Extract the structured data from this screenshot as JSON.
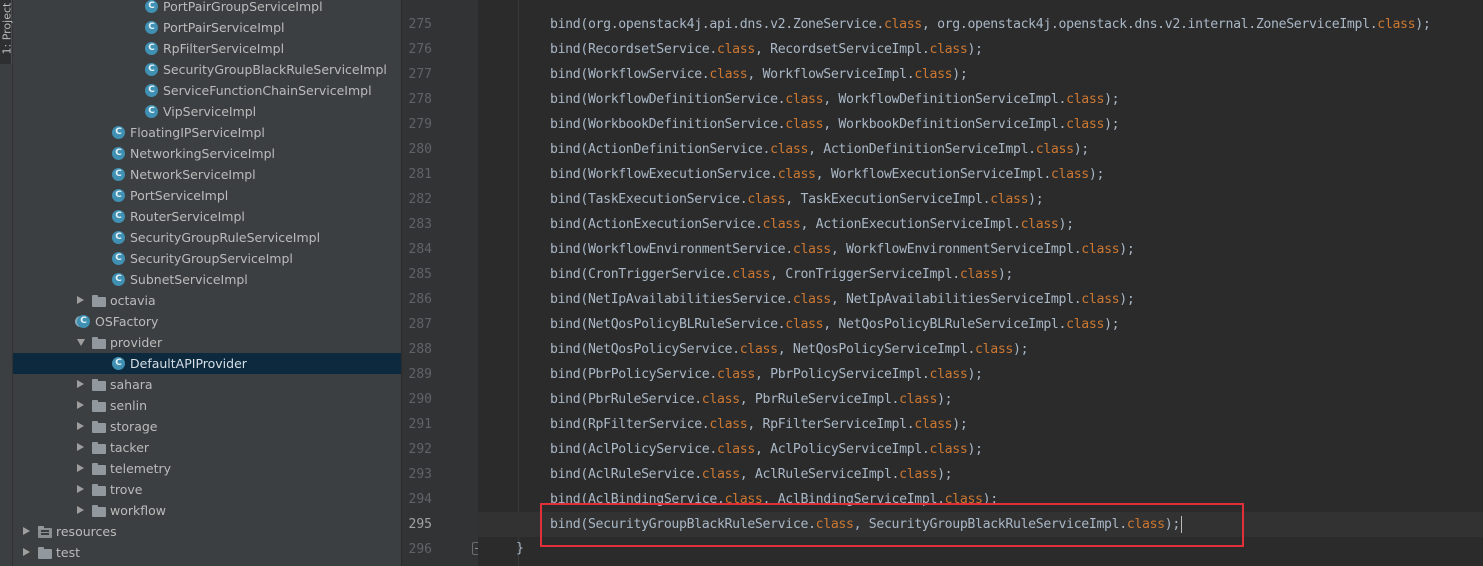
{
  "tool_strip": {
    "project_tab_label": "1: Project"
  },
  "project_tree": {
    "items": [
      {
        "label": "PortPairGroupServiceImpl",
        "kind": "class",
        "indent": 3
      },
      {
        "label": "PortPairServiceImpl",
        "kind": "class",
        "indent": 3
      },
      {
        "label": "RpFilterServiceImpl",
        "kind": "class",
        "indent": 3
      },
      {
        "label": "SecurityGroupBlackRuleServiceImpl",
        "kind": "class",
        "indent": 3
      },
      {
        "label": "ServiceFunctionChainServiceImpl",
        "kind": "class",
        "indent": 3
      },
      {
        "label": "VipServiceImpl",
        "kind": "class",
        "indent": 3
      },
      {
        "label": "FloatingIPServiceImpl",
        "kind": "class",
        "indent": 2
      },
      {
        "label": "NetworkingServiceImpl",
        "kind": "class",
        "indent": 2
      },
      {
        "label": "NetworkServiceImpl",
        "kind": "class",
        "indent": 2
      },
      {
        "label": "PortServiceImpl",
        "kind": "class",
        "indent": 2
      },
      {
        "label": "RouterServiceImpl",
        "kind": "class",
        "indent": 2
      },
      {
        "label": "SecurityGroupRuleServiceImpl",
        "kind": "class",
        "indent": 2
      },
      {
        "label": "SecurityGroupServiceImpl",
        "kind": "class",
        "indent": 2
      },
      {
        "label": "SubnetServiceImpl",
        "kind": "class",
        "indent": 2
      },
      {
        "label": "octavia",
        "kind": "folder",
        "indent": 1,
        "arrow": "right"
      },
      {
        "label": "OSFactory",
        "kind": "factory",
        "indent": 1
      },
      {
        "label": "provider",
        "kind": "folder",
        "indent": 1,
        "arrow": "down"
      },
      {
        "label": "DefaultAPIProvider",
        "kind": "class",
        "indent": 2,
        "selected": true
      },
      {
        "label": "sahara",
        "kind": "folder",
        "indent": 1,
        "arrow": "right"
      },
      {
        "label": "senlin",
        "kind": "folder",
        "indent": 1,
        "arrow": "right"
      },
      {
        "label": "storage",
        "kind": "folder",
        "indent": 1,
        "arrow": "right"
      },
      {
        "label": "tacker",
        "kind": "folder",
        "indent": 1,
        "arrow": "right"
      },
      {
        "label": "telemetry",
        "kind": "folder",
        "indent": 1,
        "arrow": "right"
      },
      {
        "label": "trove",
        "kind": "folder",
        "indent": 1,
        "arrow": "right"
      },
      {
        "label": "workflow",
        "kind": "folder",
        "indent": 1,
        "arrow": "right"
      },
      {
        "label": "resources",
        "kind": "res-folder",
        "indent": 0,
        "arrow": "right"
      },
      {
        "label": "test",
        "kind": "folder",
        "indent": 0,
        "arrow": "right"
      }
    ]
  },
  "editor": {
    "lines": [
      {
        "num": "275",
        "a": "bind(org.openstack4j.api.dns.v2.ZoneService.",
        "b": ", org.openstack4j.openstack.dns.v2.internal.ZoneServiceImpl.",
        "c": ");"
      },
      {
        "num": "276",
        "a": "bind(RecordsetService.",
        "b": ", RecordsetServiceImpl.",
        "c": ");"
      },
      {
        "num": "277",
        "a": "bind(WorkflowService.",
        "b": ", WorkflowServiceImpl.",
        "c": ");"
      },
      {
        "num": "278",
        "a": "bind(WorkflowDefinitionService.",
        "b": ", WorkflowDefinitionServiceImpl.",
        "c": ");"
      },
      {
        "num": "279",
        "a": "bind(WorkbookDefinitionService.",
        "b": ", WorkbookDefinitionServiceImpl.",
        "c": ");"
      },
      {
        "num": "280",
        "a": "bind(ActionDefinitionService.",
        "b": ", ActionDefinitionServiceImpl.",
        "c": ");"
      },
      {
        "num": "281",
        "a": "bind(WorkflowExecutionService.",
        "b": ", WorkflowExecutionServiceImpl.",
        "c": ");"
      },
      {
        "num": "282",
        "a": "bind(TaskExecutionService.",
        "b": ", TaskExecutionServiceImpl.",
        "c": ");"
      },
      {
        "num": "283",
        "a": "bind(ActionExecutionService.",
        "b": ", ActionExecutionServiceImpl.",
        "c": ");"
      },
      {
        "num": "284",
        "a": "bind(WorkflowEnvironmentService.",
        "b": ", WorkflowEnvironmentServiceImpl.",
        "c": ");"
      },
      {
        "num": "285",
        "a": "bind(CronTriggerService.",
        "b": ", CronTriggerServiceImpl.",
        "c": ");"
      },
      {
        "num": "286",
        "a": "bind(NetIpAvailabilitiesService.",
        "b": ", NetIpAvailabilitiesServiceImpl.",
        "c": ");"
      },
      {
        "num": "287",
        "a": "bind(NetQosPolicyBLRuleService.",
        "b": ", NetQosPolicyBLRuleServiceImpl.",
        "c": ");"
      },
      {
        "num": "288",
        "a": "bind(NetQosPolicyService.",
        "b": ", NetQosPolicyServiceImpl.",
        "c": ");"
      },
      {
        "num": "289",
        "a": "bind(PbrPolicyService.",
        "b": ", PbrPolicyServiceImpl.",
        "c": ");"
      },
      {
        "num": "290",
        "a": "bind(PbrRuleService.",
        "b": ", PbrRuleServiceImpl.",
        "c": ");"
      },
      {
        "num": "291",
        "a": "bind(RpFilterService.",
        "b": ", RpFilterServiceImpl.",
        "c": ");"
      },
      {
        "num": "292",
        "a": "bind(AclPolicyService.",
        "b": ", AclPolicyServiceImpl.",
        "c": ");"
      },
      {
        "num": "293",
        "a": "bind(AclRuleService.",
        "b": ", AclRuleServiceImpl.",
        "c": ");"
      },
      {
        "num": "294",
        "a": "bind(AclBindingService.",
        "b": ", AclBindingServiceImpl.",
        "c": ");"
      },
      {
        "num": "295",
        "a": "bind(SecurityGroupBlackRuleService.",
        "b": ", SecurityGroupBlackRuleServiceImpl.",
        "c": ");",
        "current": true
      }
    ],
    "keyword": "class",
    "closing_line_num": "296",
    "closing_text": "}"
  },
  "colors": {
    "highlight_box": "#e0303a",
    "keyword": "#cc7832",
    "code_text": "#a9b7c6",
    "tree_background": "#3c3f41",
    "editor_background": "#2b2b2b",
    "selected_row": "#0d293e"
  }
}
